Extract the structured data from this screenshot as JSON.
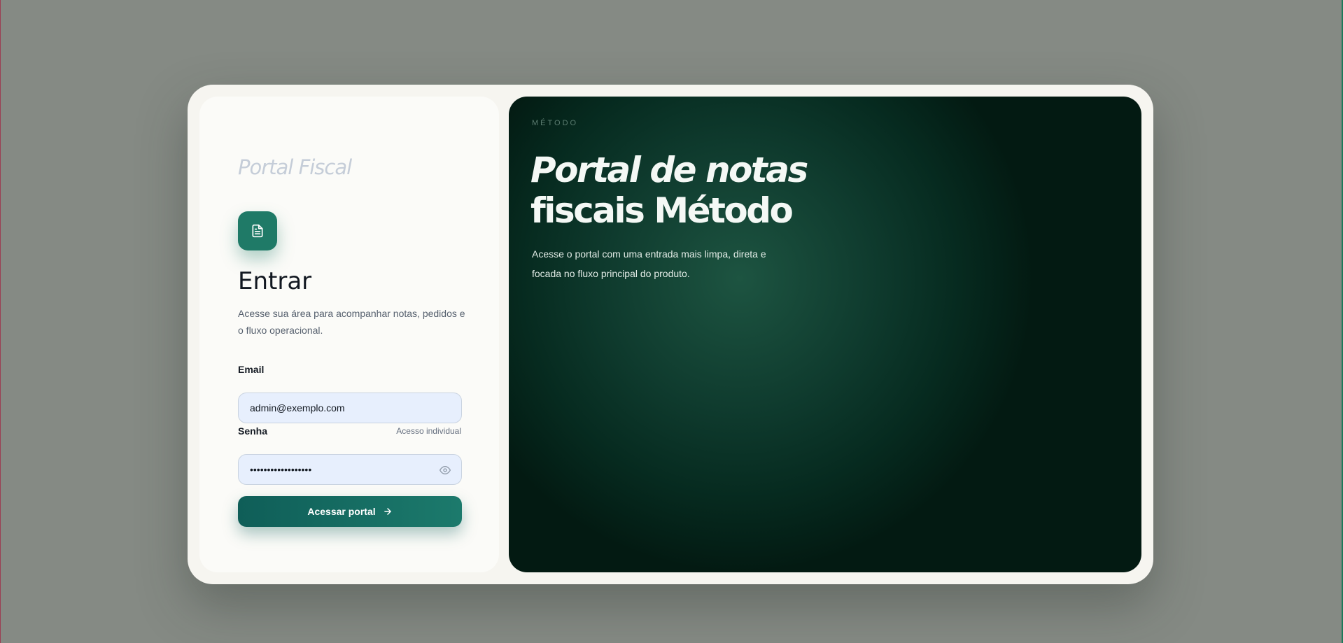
{
  "brand": "Portal Fiscal",
  "login": {
    "title": "Entrar",
    "subtitle": "Acesse sua área para acompanhar notas, pedidos e o fluxo operacional.",
    "email_label": "Email",
    "email_value": "admin@exemplo.com",
    "password_label": "Senha",
    "password_hint": "Acesso individual",
    "password_value": "••••••••••••••••••",
    "submit_label": "Acessar portal"
  },
  "hero": {
    "overline": "MÉTODO",
    "title_line1": "Portal de notas",
    "title_line2": "fiscais Método",
    "description": "Acesse o portal com uma entrada mais limpa, direta e focada no fluxo principal do produto."
  },
  "colors": {
    "accent": "#1f7a67",
    "hero_bg": "#0f3b2e",
    "input_bg": "#e7effd"
  },
  "icons": {
    "logo": "document-icon",
    "password_toggle": "eye-icon",
    "submit": "arrow-right-icon"
  }
}
